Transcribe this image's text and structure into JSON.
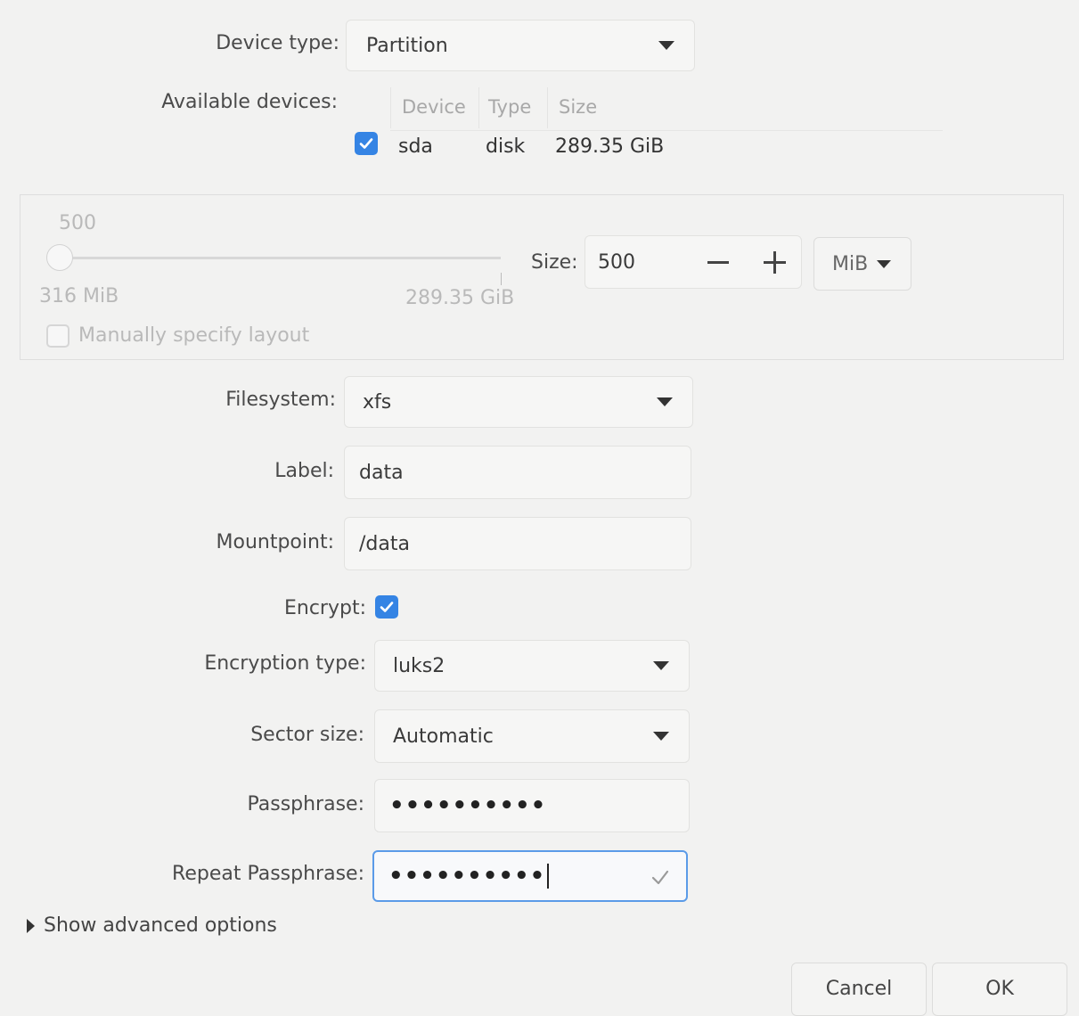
{
  "device_type": {
    "label": "Device type:",
    "value": "Partition"
  },
  "available_devices": {
    "label": "Available devices:",
    "columns": [
      "Device",
      "Type",
      "Size"
    ],
    "rows": [
      {
        "checked": true,
        "device": "sda",
        "type": "disk",
        "size": "289.35 GiB"
      }
    ]
  },
  "size": {
    "slider_value_label": "500",
    "min_label": "316 MiB",
    "max_label": "289.35 GiB",
    "size_label": "Size:",
    "value": "500",
    "unit": "MiB",
    "manual_layout_label": "Manually specify layout",
    "manual_layout_checked": false
  },
  "filesystem": {
    "label": "Filesystem:",
    "value": "xfs"
  },
  "label_field": {
    "label": "Label:",
    "value": "data"
  },
  "mountpoint": {
    "label": "Mountpoint:",
    "value": "/data"
  },
  "encrypt": {
    "label": "Encrypt:",
    "checked": true
  },
  "encryption_type": {
    "label": "Encryption type:",
    "value": "luks2"
  },
  "sector_size": {
    "label": "Sector size:",
    "value": "Automatic"
  },
  "passphrase": {
    "label": "Passphrase:",
    "masked": "••••••••••"
  },
  "repeat_passphrase": {
    "label": "Repeat Passphrase:",
    "masked": "••••••••••"
  },
  "advanced": {
    "label": "Show advanced options"
  },
  "buttons": {
    "cancel": "Cancel",
    "ok": "OK"
  },
  "colors": {
    "accent": "#3584e4",
    "background": "#f2f2f1"
  }
}
